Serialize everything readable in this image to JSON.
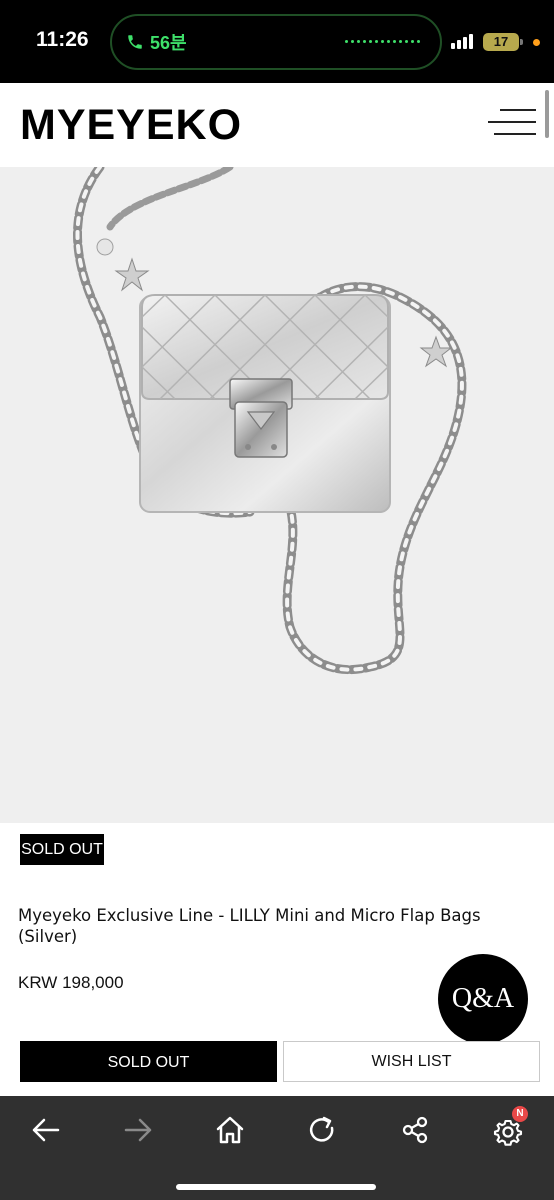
{
  "status_bar": {
    "time": "11:26",
    "call_duration": "56분",
    "battery_level": "17",
    "call_color": "#3ee06a"
  },
  "header": {
    "logo": "MYEYEKO",
    "menu_icon": "hamburger-menu-icon"
  },
  "product": {
    "image_alt_subject": "silver quilted mini flap bag with chain strap",
    "badge": "SOLD OUT",
    "title": "Myeyeko Exclusive Line - LILLY Mini and Micro Flap Bags (Silver)",
    "price": "KRW 198,000",
    "qa_label": "Q&A"
  },
  "actions": {
    "sold_out_label": "SOLD OUT",
    "wish_list_label": "WISH LIST"
  },
  "toolbar": {
    "items": [
      {
        "icon": "back-arrow-icon"
      },
      {
        "icon": "forward-arrow-icon"
      },
      {
        "icon": "home-icon"
      },
      {
        "icon": "reload-icon"
      },
      {
        "icon": "share-icon"
      },
      {
        "icon": "settings-icon",
        "badge": "N"
      }
    ],
    "background": "#303030"
  }
}
